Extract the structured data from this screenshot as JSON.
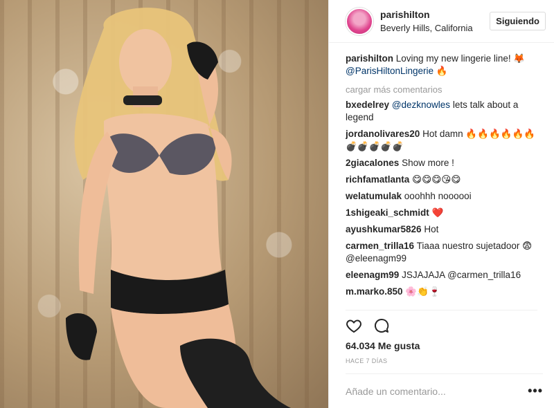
{
  "header": {
    "username": "parishilton",
    "location": "Beverly Hills, California",
    "follow_label": "Siguiendo"
  },
  "caption": {
    "user": "parishilton",
    "text": "Loving my new lingerie line! 🦊",
    "mention": "@ParisHiltonLingerie",
    "emoji": "🔥"
  },
  "load_more_label": "cargar más comentarios",
  "comments": [
    {
      "user": "bxedelrey",
      "mention": "@dezknowles",
      "text": "lets talk about a legend"
    },
    {
      "user": "jordanolivares20",
      "mention": "",
      "text": "Hot damn 🔥🔥🔥🔥🔥🔥💣💣💣💣💣"
    },
    {
      "user": "2giacalones",
      "mention": "",
      "text": "Show more !"
    },
    {
      "user": "richfamatlanta",
      "mention": "",
      "text": "😋😋😋😘😋"
    },
    {
      "user": "welatumulak",
      "mention": "",
      "text": "ooohhh noooooi"
    },
    {
      "user": "1shigeaki_schmidt",
      "mention": "",
      "text": "❤️"
    },
    {
      "user": "ayushkumar5826",
      "mention": "",
      "text": "Hot"
    },
    {
      "user": "carmen_trilla16",
      "mention": "",
      "text": "Tiaaa nuestro sujetadoor 😨 @eleenagm99"
    },
    {
      "user": "eleenagm99",
      "mention": "",
      "text": "JSJAJAJA @carmen_trilla16"
    },
    {
      "user": "m.marko.850",
      "mention": "",
      "text": "🌸👏🍷"
    }
  ],
  "likes_label": "64.034 Me gusta",
  "time_label": "HACE 7 DÍAS",
  "add_comment_placeholder": "Añade un comentario...",
  "more_options_label": "•••",
  "colors": {
    "mention": "#003569",
    "muted": "#999999",
    "border": "#efefef",
    "text": "#262626"
  },
  "icons": [
    "heart-icon",
    "comment-icon",
    "more-options-icon"
  ]
}
